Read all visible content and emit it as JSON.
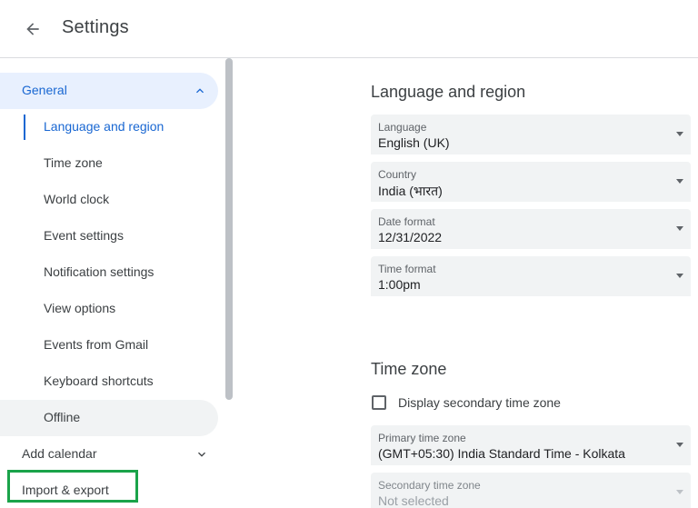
{
  "header": {
    "back_icon": "arrow-back-icon",
    "title": "Settings"
  },
  "sidebar": {
    "general": {
      "label": "General",
      "expanded": true,
      "icon": "chevron-up-icon"
    },
    "sub_items": [
      {
        "label": "Language and region",
        "active": true
      },
      {
        "label": "Time zone"
      },
      {
        "label": "World clock"
      },
      {
        "label": "Event settings"
      },
      {
        "label": "Notification settings"
      },
      {
        "label": "View options"
      },
      {
        "label": "Events from Gmail"
      },
      {
        "label": "Keyboard shortcuts"
      },
      {
        "label": "Offline"
      }
    ],
    "add_calendar": {
      "label": "Add calendar",
      "icon": "chevron-down-icon"
    },
    "import_export": {
      "label": "Import & export",
      "highlight_color": "#1aa34a"
    }
  },
  "main": {
    "language_region": {
      "title": "Language and region",
      "fields": [
        {
          "label": "Language",
          "value": "English (UK)"
        },
        {
          "label": "Country",
          "value": "India (भारत)"
        },
        {
          "label": "Date format",
          "value": "12/31/2022"
        },
        {
          "label": "Time format",
          "value": "1:00pm"
        }
      ]
    },
    "time_zone": {
      "title": "Time zone",
      "secondary_checkbox": {
        "label": "Display secondary time zone",
        "checked": false
      },
      "primary": {
        "label": "Primary time zone",
        "value": "(GMT+05:30) India Standard Time - Kolkata"
      },
      "secondary": {
        "label": "Secondary time zone",
        "value": "Not selected",
        "disabled": true
      }
    }
  },
  "colors": {
    "accent": "#1967d2",
    "active_bg": "#e8f0fe",
    "field_bg": "#f1f3f4",
    "text": "#3c4043"
  }
}
